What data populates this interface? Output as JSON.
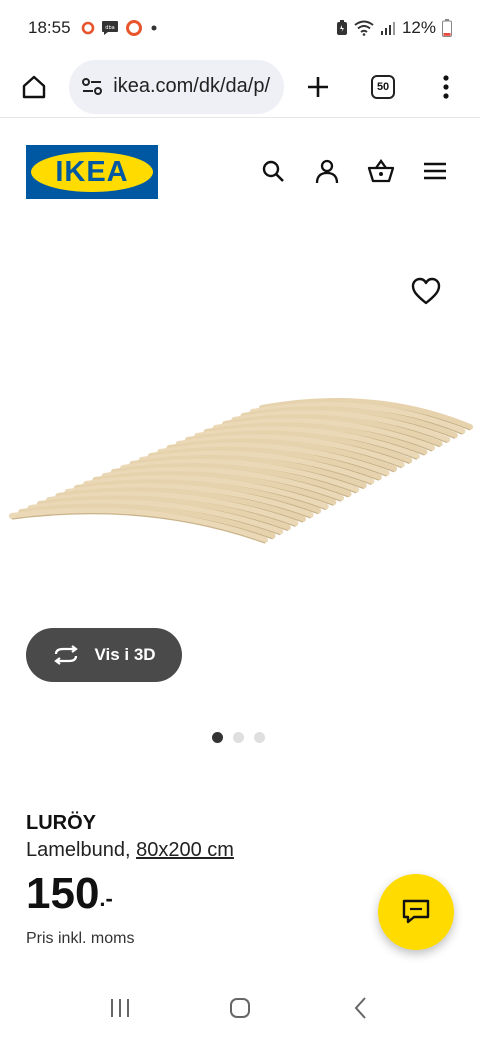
{
  "status_bar": {
    "time": "18:55",
    "battery": "12%",
    "icons": [
      "notification-ring-icon",
      "chat-bubble-icon",
      "notification-ring-icon",
      "dot-icon",
      "battery-saver-icon",
      "wifi-icon",
      "signal-icon",
      "battery-icon"
    ]
  },
  "browser": {
    "url": "ikea.com/dk/da/p/",
    "tab_count": "50"
  },
  "site": {
    "logo_text": "IKEA",
    "colors": {
      "brand_blue": "#0058a3",
      "brand_yellow": "#ffdb00"
    }
  },
  "product": {
    "view3d_label": "Vis i 3D",
    "name": "LURÖY",
    "desc_prefix": "Lamelbund, ",
    "size": "80x200 cm",
    "price": "150",
    "price_suffix": ".-",
    "vat_note": "Pris inkl. moms"
  }
}
